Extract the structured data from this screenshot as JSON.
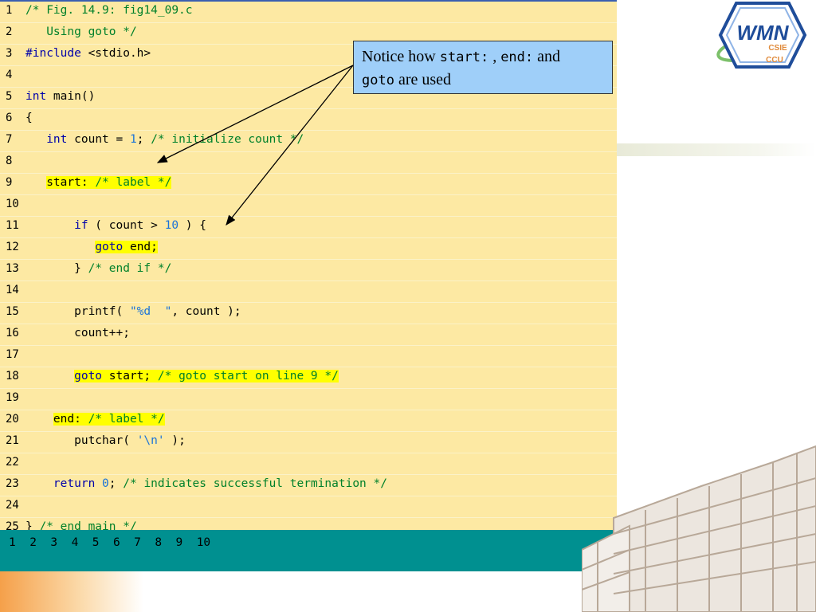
{
  "code_lines": [
    {
      "num": "1",
      "segments": [
        {
          "t": "/* Fig. 14.9: fig14_09.c",
          "c": "cm"
        }
      ]
    },
    {
      "num": "2",
      "segments": [
        {
          "t": "   Using goto */",
          "c": "cm"
        }
      ]
    },
    {
      "num": "3",
      "segments": [
        {
          "t": "#include",
          "c": "kw"
        },
        {
          "t": " <stdio.h>",
          "c": ""
        }
      ]
    },
    {
      "num": "4",
      "segments": []
    },
    {
      "num": "5",
      "segments": [
        {
          "t": "int",
          "c": "kw"
        },
        {
          "t": " main()",
          "c": ""
        }
      ]
    },
    {
      "num": "6",
      "segments": [
        {
          "t": "{",
          "c": ""
        }
      ]
    },
    {
      "num": "7",
      "segments": [
        {
          "t": "   ",
          "c": ""
        },
        {
          "t": "int",
          "c": "kw"
        },
        {
          "t": " count = ",
          "c": ""
        },
        {
          "t": "1",
          "c": "num"
        },
        {
          "t": "; ",
          "c": ""
        },
        {
          "t": "/* initialize count */",
          "c": "cm"
        }
      ]
    },
    {
      "num": "8",
      "segments": []
    },
    {
      "num": "9",
      "segments": [
        {
          "t": "   ",
          "c": ""
        },
        {
          "t": "start: ",
          "c": "hl"
        },
        {
          "t": "/* label */",
          "c": "cm hl"
        }
      ]
    },
    {
      "num": "10",
      "segments": []
    },
    {
      "num": "11",
      "segments": [
        {
          "t": "       ",
          "c": ""
        },
        {
          "t": "if",
          "c": "kw"
        },
        {
          "t": " ( count > ",
          "c": ""
        },
        {
          "t": "10",
          "c": "num"
        },
        {
          "t": " ) {",
          "c": ""
        }
      ]
    },
    {
      "num": "12",
      "segments": [
        {
          "t": "          ",
          "c": ""
        },
        {
          "t": "goto",
          "c": "kw hl"
        },
        {
          "t": " end;",
          "c": "hl"
        }
      ]
    },
    {
      "num": "13",
      "segments": [
        {
          "t": "       } ",
          "c": ""
        },
        {
          "t": "/* end if */",
          "c": "cm"
        }
      ]
    },
    {
      "num": "14",
      "segments": []
    },
    {
      "num": "15",
      "segments": [
        {
          "t": "       printf( ",
          "c": ""
        },
        {
          "t": "\"%d  \"",
          "c": "str"
        },
        {
          "t": ", count );",
          "c": ""
        }
      ]
    },
    {
      "num": "16",
      "segments": [
        {
          "t": "       count++;",
          "c": ""
        }
      ]
    },
    {
      "num": "17",
      "segments": []
    },
    {
      "num": "18",
      "segments": [
        {
          "t": "       ",
          "c": ""
        },
        {
          "t": "goto",
          "c": "kw hl"
        },
        {
          "t": " start; ",
          "c": "hl"
        },
        {
          "t": "/* goto start on line 9 */",
          "c": "cm hl"
        }
      ]
    },
    {
      "num": "19",
      "segments": []
    },
    {
      "num": "20",
      "segments": [
        {
          "t": "    ",
          "c": ""
        },
        {
          "t": "end: ",
          "c": "hl"
        },
        {
          "t": "/* label */",
          "c": "cm hl"
        }
      ]
    },
    {
      "num": "21",
      "segments": [
        {
          "t": "       putchar( ",
          "c": ""
        },
        {
          "t": "'\\n'",
          "c": "str"
        },
        {
          "t": " );",
          "c": ""
        }
      ]
    },
    {
      "num": "22",
      "segments": []
    },
    {
      "num": "23",
      "segments": [
        {
          "t": "    ",
          "c": ""
        },
        {
          "t": "return",
          "c": "kw"
        },
        {
          "t": " ",
          "c": ""
        },
        {
          "t": "0",
          "c": "num"
        },
        {
          "t": "; ",
          "c": ""
        },
        {
          "t": "/* indicates successful termination */",
          "c": "cm"
        }
      ]
    },
    {
      "num": "24",
      "segments": []
    },
    {
      "num": "25",
      "segments": [
        {
          "t": "} ",
          "c": ""
        },
        {
          "t": "/* end main */",
          "c": "cm"
        }
      ]
    }
  ],
  "output": {
    "text": "1  2  3  4  5  6  7  8  9  10"
  },
  "callout": {
    "part1": "Notice how ",
    "code1": "start:",
    "part2": " , ",
    "code2": "end:",
    "part3": " and",
    "code3": "goto",
    "part4": " are used"
  },
  "logo": {
    "text": "WMN",
    "sub1": "CSIE",
    "sub2": "CCU"
  },
  "colors": {
    "code_background": "#fde9a3",
    "output_background": "#009090",
    "callout_background": "#9fcff9",
    "keyword": "#0000aa",
    "comment": "#00802a",
    "literal": "#1a73d9",
    "highlight": "#ffff00"
  }
}
